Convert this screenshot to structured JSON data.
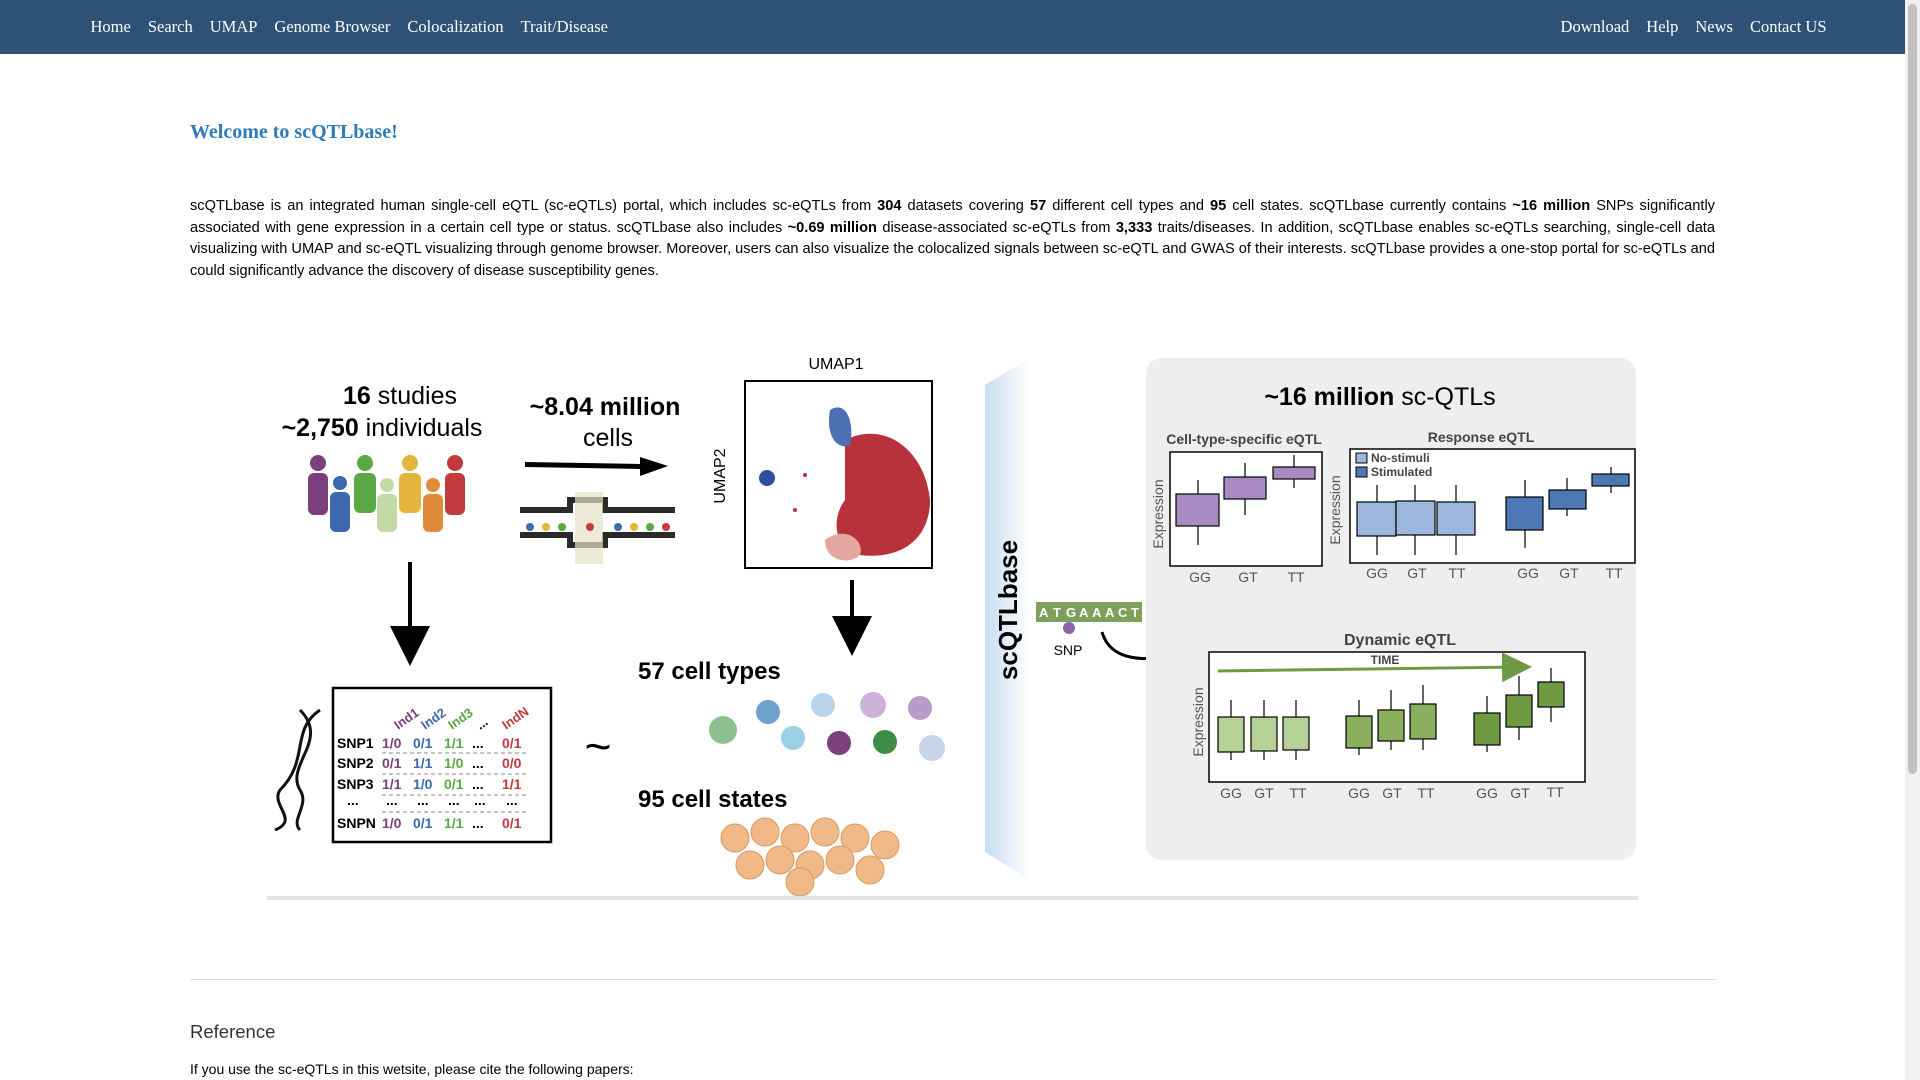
{
  "nav": {
    "left": [
      "Home",
      "Search",
      "UMAP",
      "Genome Browser",
      "Colocalization",
      "Trait/Disease"
    ],
    "right": [
      "Download",
      "Help",
      "News",
      "Contact US"
    ]
  },
  "welcome_title": "Welcome to scQTLbase!",
  "intro": {
    "t1": "scQTLbase is an integrated human single-cell eQTL (sc-eQTLs) portal, which includes sc-eQTLs from ",
    "b1": "304",
    "t2": " datasets covering ",
    "b2": "57",
    "t3": " different cell types and ",
    "b3": "95",
    "t4": " cell states. scQTLbase currently contains ",
    "b4": "~16 million",
    "t5": " SNPs significantly associated with gene expression in a certain cell type or status. scQTLbase also includes ",
    "b5": "~0.69 million",
    "t6": " disease-associated sc-eQTLs from ",
    "b6": "3,333",
    "t7": " traits/diseases. In addition, scQTLbase enables sc-eQTLs searching, single-cell data visualizing with UMAP and sc-eQTL visualizing through genome browser. Moreover, users can also visualize the colocalized signals between sc-eQTL and GWAS of their interests. scQTLbase provides a one-stop portal for sc-eQTLs and could significantly advance the discovery of disease susceptibility genes."
  },
  "figure": {
    "studies_num": "16",
    "studies_word": " studies",
    "indiv_num": "~2,750",
    "indiv_word": " individuals",
    "cells_line1": "~8.04 million",
    "cells_line2": "cells",
    "umap1": "UMAP1",
    "umap2": "UMAP2",
    "matrix_cols": [
      "Ind1",
      "Ind2",
      "Ind3",
      "...",
      "IndN"
    ],
    "matrix_rows": [
      {
        "snp": "SNP1",
        "vals": [
          "1/0",
          "0/1",
          "1/1",
          "...",
          "0/1"
        ]
      },
      {
        "snp": "SNP2",
        "vals": [
          "0/1",
          "1/1",
          "1/0",
          "...",
          "0/0"
        ]
      },
      {
        "snp": "SNP3",
        "vals": [
          "1/1",
          "1/0",
          "0/1",
          "...",
          "1/1"
        ]
      },
      {
        "snp": "...",
        "vals": [
          "...",
          "...",
          "...",
          "...",
          "..."
        ]
      },
      {
        "snp": "SNPN",
        "vals": [
          "1/0",
          "0/1",
          "1/1",
          "...",
          "0/1"
        ]
      }
    ],
    "tilde": "~",
    "cell_types": "57 cell types",
    "cell_states": "95 cell states",
    "brand": "scQTLbase",
    "snp_seq": [
      "A",
      "T",
      "G",
      "A",
      "A",
      "A",
      "C",
      "T"
    ],
    "snp_label": "SNP",
    "qtl_num": "~16 million",
    "qtl_word": " sc-QTLs",
    "ct_title": "Cell-type-specific eQTL",
    "resp_title": "Response eQTL",
    "dyn_title": "Dynamic eQTL",
    "expression": "Expression",
    "genotypes": [
      "GG",
      "GT",
      "TT"
    ],
    "legend_nostim": "No-stimuli",
    "legend_stim": "Stimulated",
    "time": "TIME",
    "colors": {
      "purple": "#a98bc4",
      "purple_dark": "#7e5c9f",
      "blue_light": "#9db7dc",
      "blue_dark": "#4d78b3",
      "green_light": "#b5d195",
      "green_dark": "#6f9a43",
      "red": "#b8323c",
      "panel_bg": "#eeeeee"
    }
  },
  "reference": {
    "title": "Reference",
    "text": "If you use the sc-eQTLs in this wetsite, please cite the following papers:"
  }
}
